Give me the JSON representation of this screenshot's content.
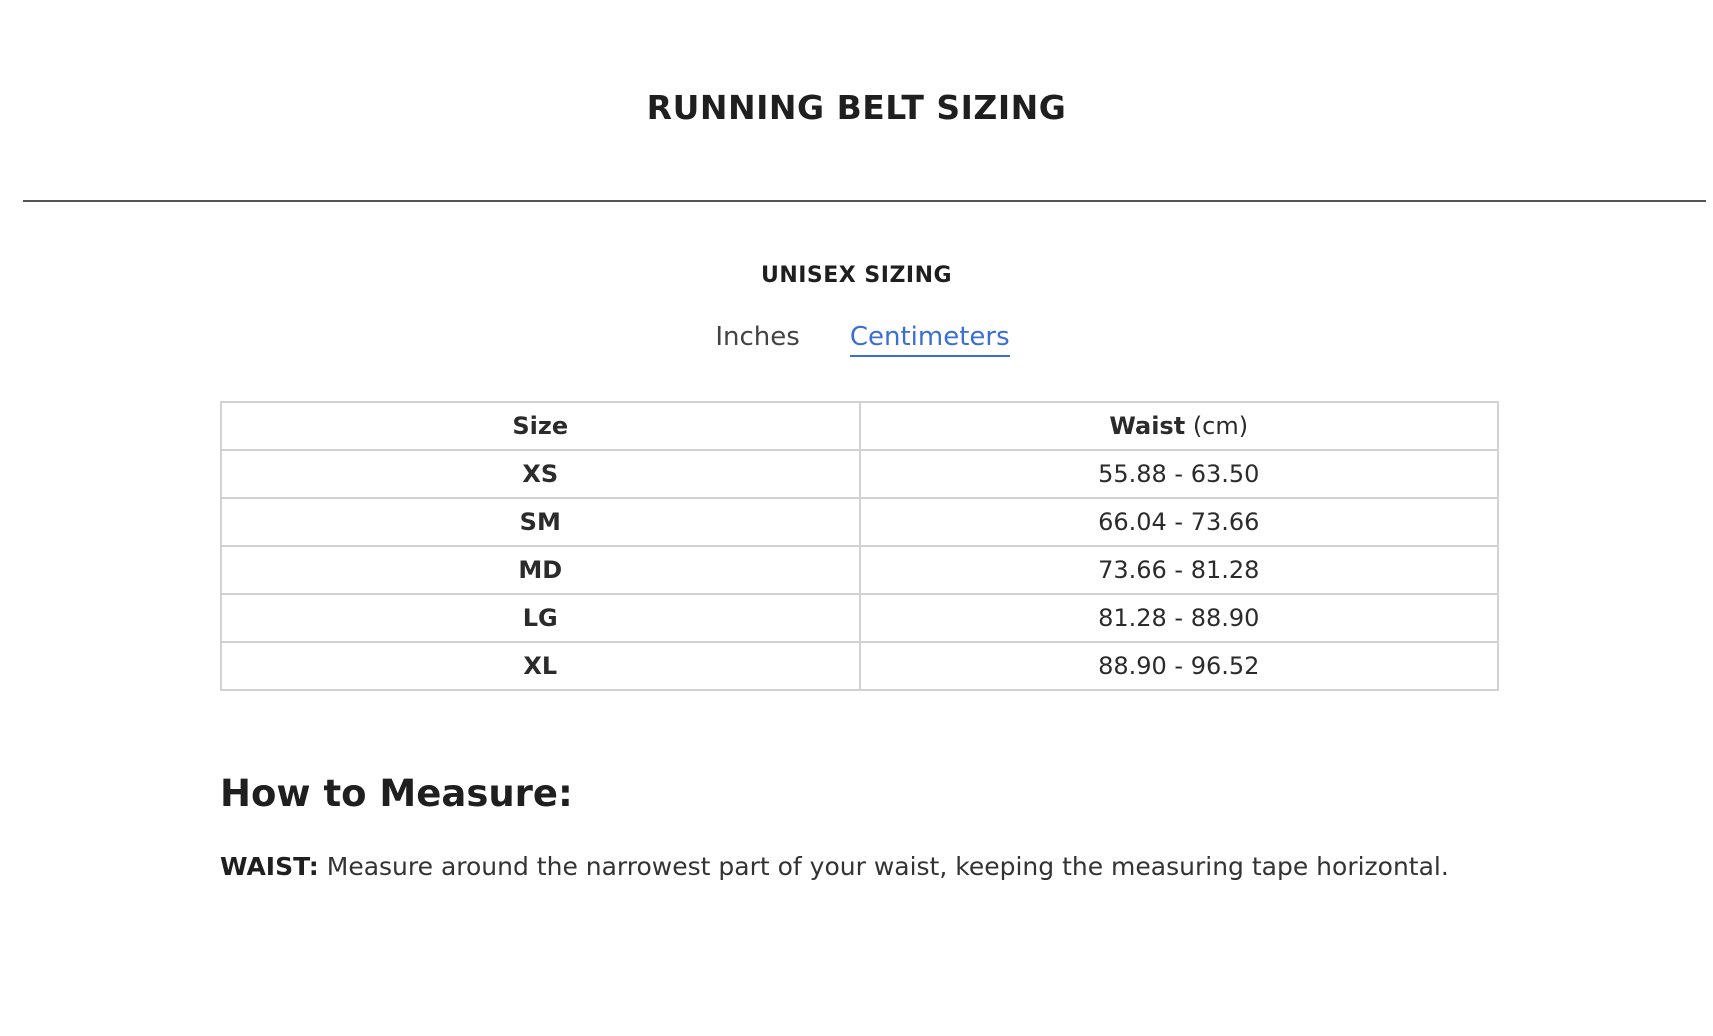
{
  "page": {
    "title": "RUNNING BELT SIZING"
  },
  "section": {
    "title": "UNISEX SIZING"
  },
  "unit_tabs": {
    "inches_label": "Inches",
    "centimeters_label": "Centimeters",
    "active": "Centimeters"
  },
  "table": {
    "headers": {
      "size": "Size",
      "waist": "Waist",
      "waist_unit": "(cm)"
    },
    "rows": [
      {
        "size": "XS",
        "waist": "55.88 - 63.50"
      },
      {
        "size": "SM",
        "waist": "66.04 - 73.66"
      },
      {
        "size": "MD",
        "waist": "73.66 - 81.28"
      },
      {
        "size": "LG",
        "waist": "81.28 - 88.90"
      },
      {
        "size": "XL",
        "waist": "88.90 - 96.52"
      }
    ]
  },
  "measure": {
    "heading": "How to Measure:",
    "waist_label": "WAIST:",
    "waist_text": "Measure around the narrowest part of your waist, keeping the measuring tape horizontal."
  },
  "colors": {
    "accent": "#3b6fd4",
    "text": "#222222",
    "table_border": "#d2d2d2"
  }
}
